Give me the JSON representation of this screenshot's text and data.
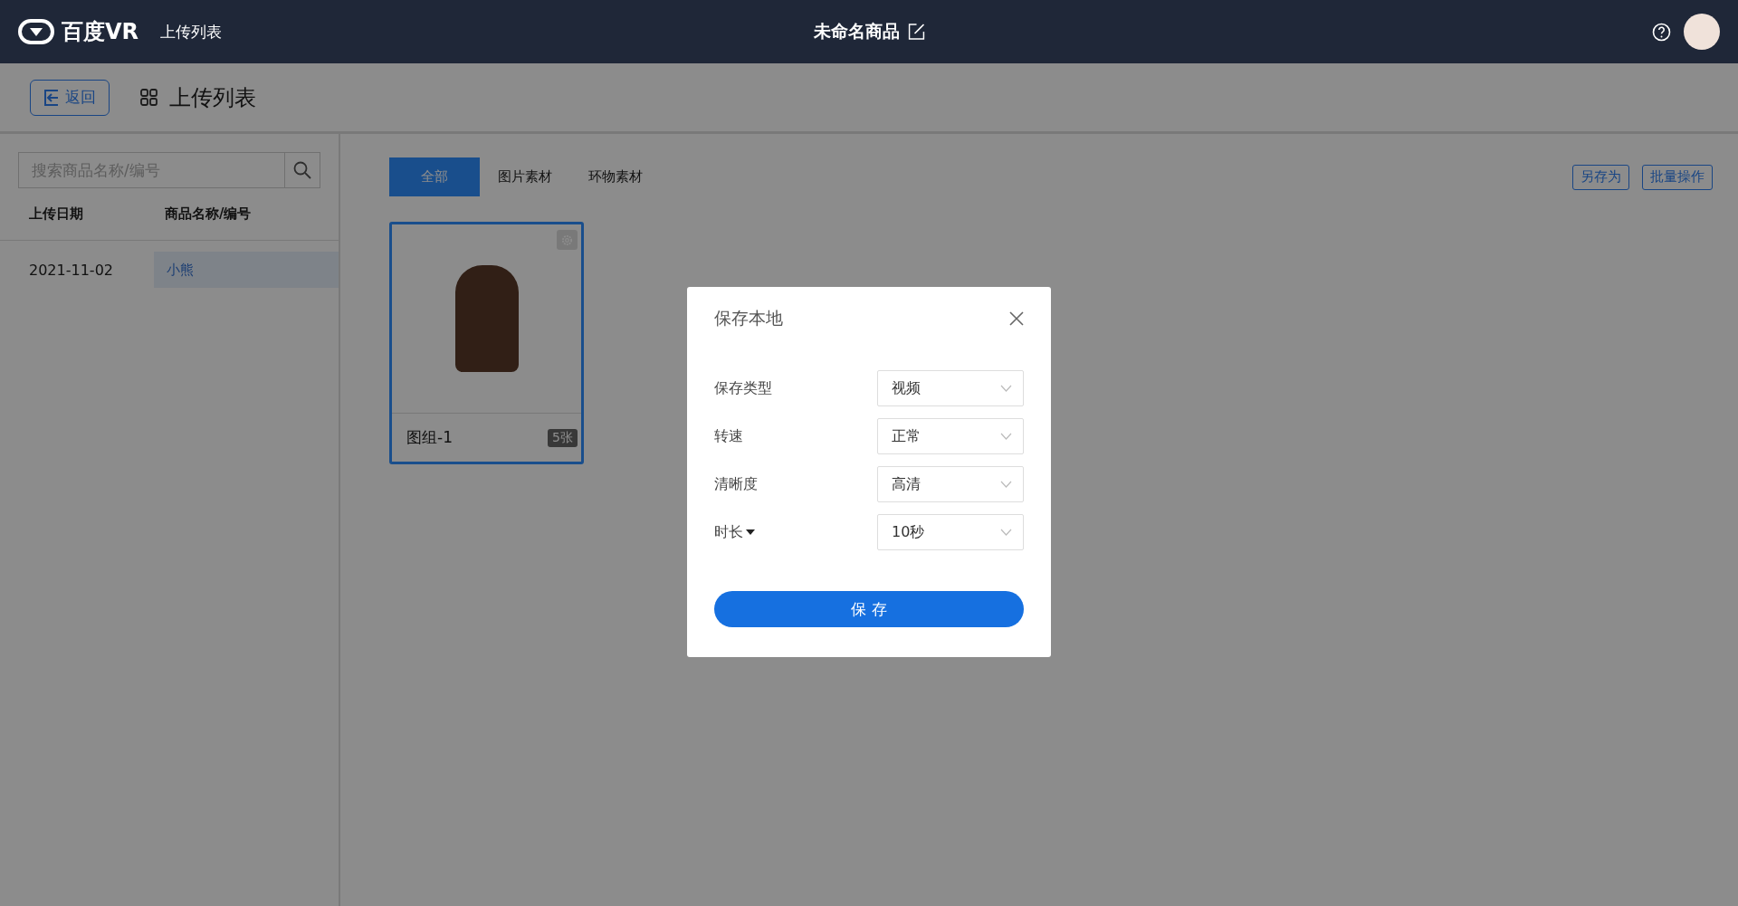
{
  "header": {
    "logo_text": "百度VR",
    "nav": "上传列表",
    "title": "未命名商品"
  },
  "toolbar": {
    "back": "返回",
    "title": "上传列表"
  },
  "sidebar": {
    "search": {
      "placeholder": "搜索商品名称/编号"
    },
    "columns": [
      "上传日期",
      "商品名称/编号"
    ],
    "rows": [
      {
        "date": "2021-11-02",
        "name": "小熊",
        "selected": true
      }
    ]
  },
  "tabs": [
    {
      "label": "全部",
      "selected": true
    },
    {
      "label": "图片素材",
      "selected": false
    },
    {
      "label": "环物素材",
      "selected": false
    }
  ],
  "actions": [
    "另存为",
    "批量操作"
  ],
  "cards": [
    {
      "name": "图组-1",
      "count": "5张",
      "selected": true
    }
  ],
  "dialog": {
    "title": "保存本地",
    "fields": [
      {
        "label": "保存类型",
        "value": "视频",
        "label_menu": false
      },
      {
        "label": "转速",
        "value": "正常",
        "label_menu": false
      },
      {
        "label": "清晰度",
        "value": "高清",
        "label_menu": false
      },
      {
        "label": "时长",
        "value": "10秒",
        "label_menu": true
      }
    ],
    "submit": "保 存"
  }
}
